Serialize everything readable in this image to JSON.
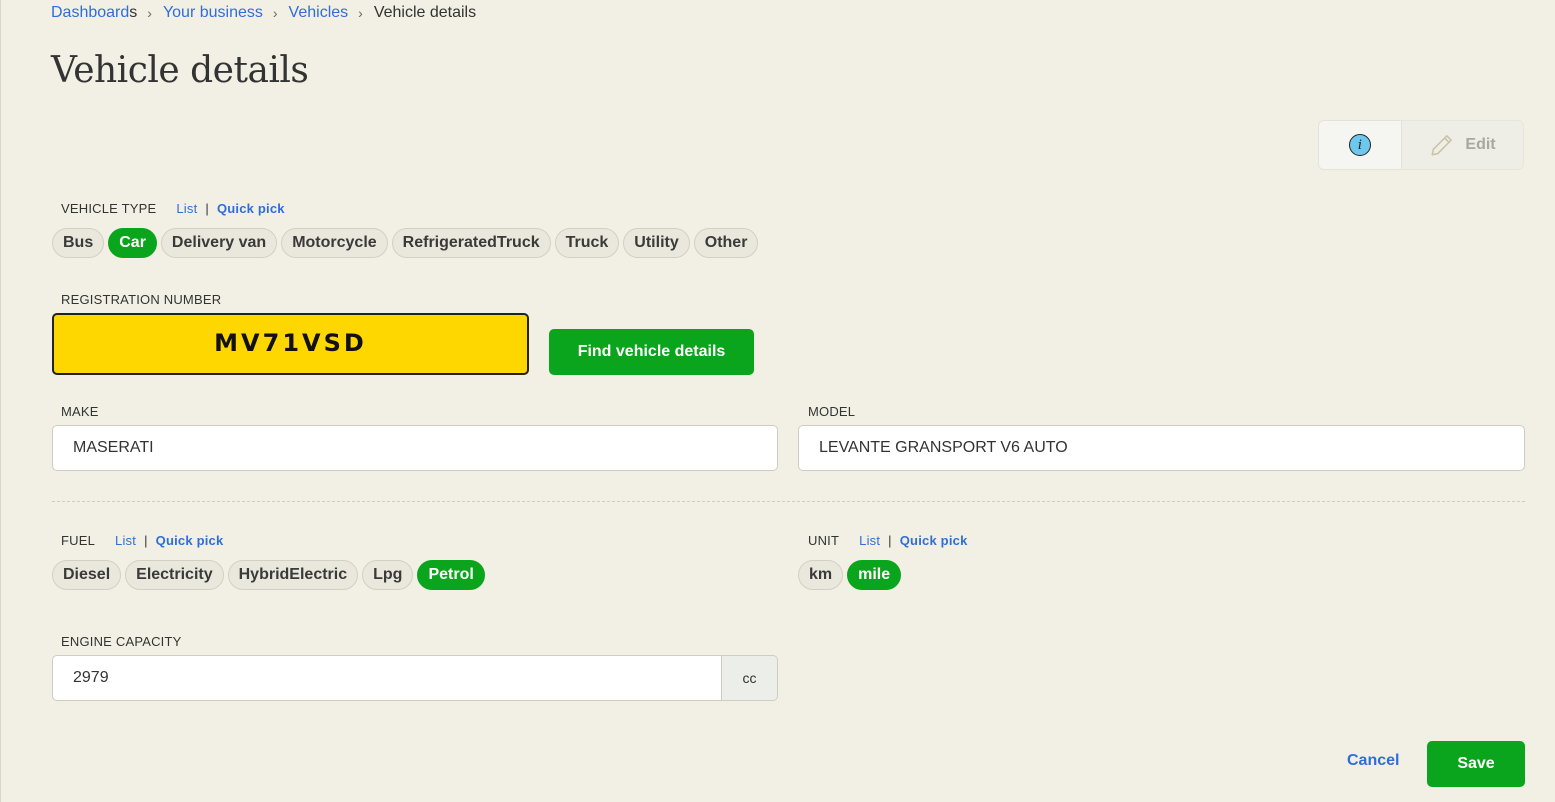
{
  "breadcrumb": {
    "items": [
      "Dashboard",
      "s",
      "Your business",
      "Vehicles"
    ],
    "current": "Vehicle details"
  },
  "page": {
    "title": "Vehicle details"
  },
  "actions": {
    "info_icon": "info-icon",
    "edit_label": "Edit",
    "edit_icon": "pencil-icon"
  },
  "vehicle_type": {
    "label": "VEHICLE TYPE",
    "list_label": "List",
    "separator": "|",
    "quick_pick_label": "Quick pick",
    "options": [
      "Bus",
      "Car",
      "Delivery van",
      "Motorcycle",
      "RefrigeratedTruck",
      "Truck",
      "Utility",
      "Other"
    ],
    "selected": "Car"
  },
  "registration": {
    "label": "REGISTRATION NUMBER",
    "value": "MV71VSD",
    "find_button": "Find vehicle details"
  },
  "make": {
    "label": "MAKE",
    "value": "MASERATI"
  },
  "model": {
    "label": "MODEL",
    "value": "LEVANTE GRANSPORT V6 AUTO"
  },
  "fuel": {
    "label": "FUEL",
    "list_label": "List",
    "separator": "|",
    "quick_pick_label": "Quick pick",
    "options": [
      "Diesel",
      "Electricity",
      "HybridElectric",
      "Lpg",
      "Petrol"
    ],
    "selected": "Petrol"
  },
  "unit": {
    "label": "UNIT",
    "list_label": "List",
    "separator": "|",
    "quick_pick_label": "Quick pick",
    "options": [
      "km",
      "mile"
    ],
    "selected": "mile"
  },
  "engine_capacity": {
    "label": "ENGINE CAPACITY",
    "value": "2979",
    "unit": "cc"
  },
  "footer": {
    "cancel_label": "Cancel",
    "save_label": "Save"
  },
  "colors": {
    "accent_green": "#0aa51c",
    "link_blue": "#2f6ed8",
    "plate_yellow": "#ffd700",
    "background": "#f2f0e4"
  }
}
